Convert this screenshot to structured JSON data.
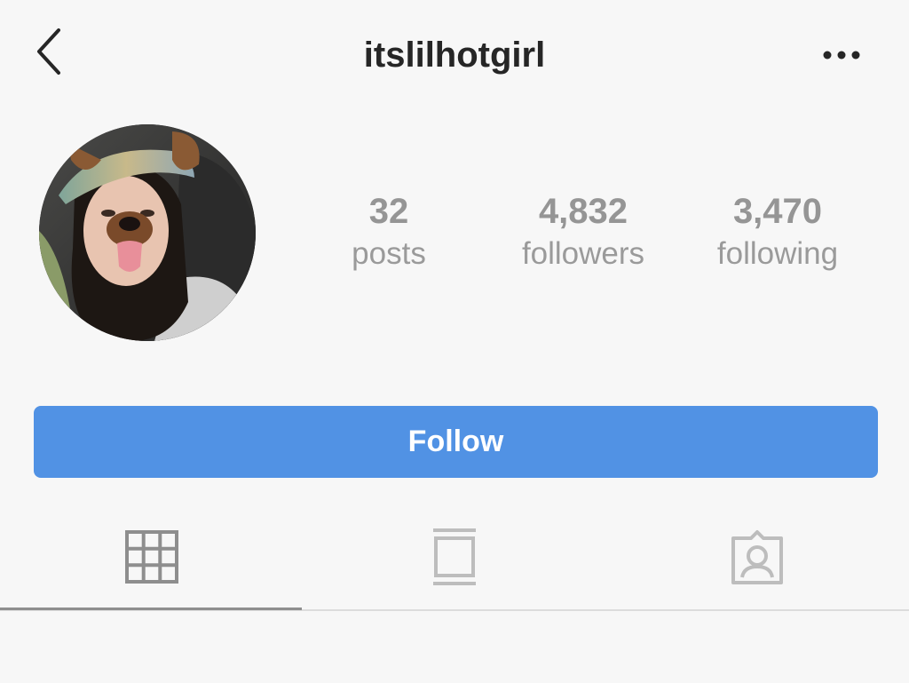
{
  "header": {
    "username": "itslilhotgirl",
    "back_icon": "chevron-left-icon",
    "more_icon": "more-dots-icon"
  },
  "profile": {
    "avatar": "profile-photo"
  },
  "stats": [
    {
      "value": "32",
      "label": "posts"
    },
    {
      "value": "4,832",
      "label": "followers"
    },
    {
      "value": "3,470",
      "label": "following"
    }
  ],
  "follow_button": {
    "label": "Follow",
    "color": "#5192e4"
  },
  "tabs": [
    {
      "icon": "grid-icon",
      "active": true
    },
    {
      "icon": "feed-icon",
      "active": false
    },
    {
      "icon": "tagged-person-icon",
      "active": false
    }
  ],
  "colors": {
    "background": "#f7f7f7",
    "title": "#262626",
    "stat_text": "#999999",
    "active_tab": "#8e8e8e",
    "inactive_tab": "#bdbdbd"
  }
}
